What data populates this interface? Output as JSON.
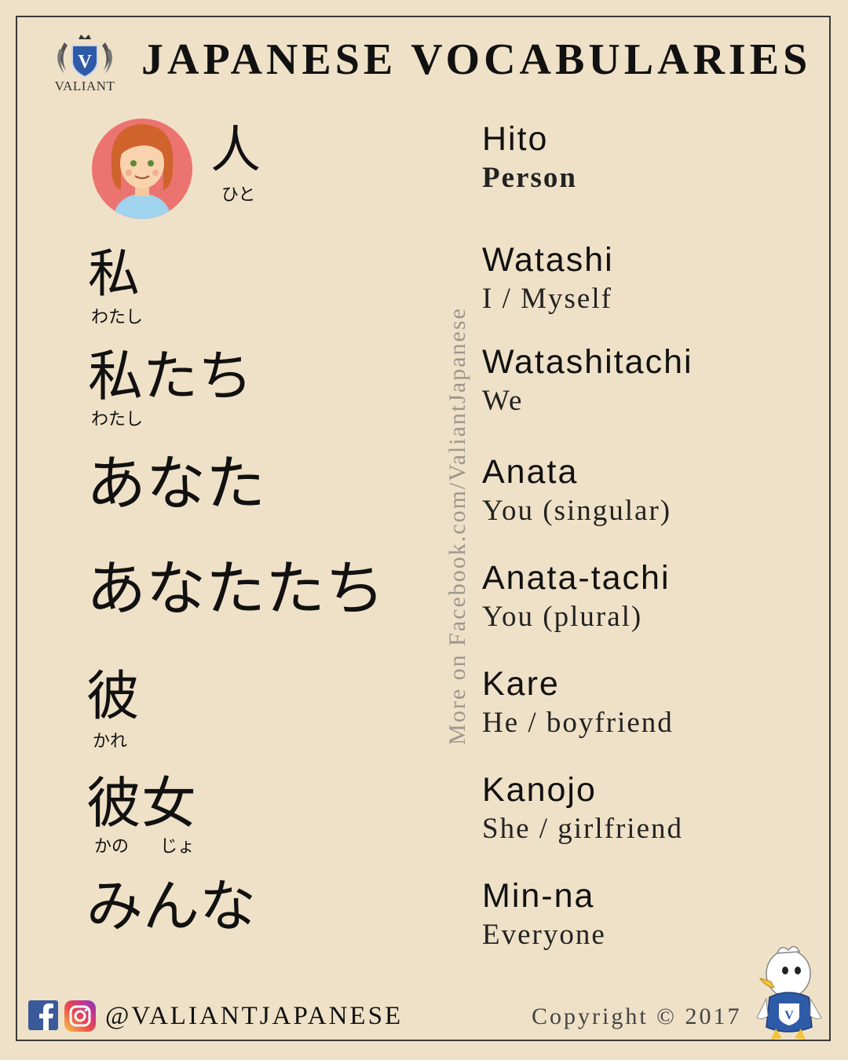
{
  "header": {
    "logo_text": "VALIANT",
    "title": "JAPANESE VOCABULARIES"
  },
  "side_text": "More on Facebook.com/ValiantJapanese",
  "entries": [
    {
      "kanji": "人",
      "furigana": "ひと",
      "romaji": "Hito",
      "meaning": "Person"
    },
    {
      "kanji": "私",
      "furigana": "わたし",
      "romaji": "Watashi",
      "meaning": "I / Myself"
    },
    {
      "kanji": "私たち",
      "furigana": "わたし",
      "romaji": "Watashitachi",
      "meaning": "We"
    },
    {
      "kanji": "あなた",
      "furigana": "",
      "romaji": "Anata",
      "meaning": "You (singular)"
    },
    {
      "kanji": "あなたたち",
      "furigana": "",
      "romaji": "Anata-tachi",
      "meaning": "You (plural)"
    },
    {
      "kanji": "彼",
      "furigana": "かれ",
      "romaji": "Kare",
      "meaning": "He / boyfriend"
    },
    {
      "kanji": "彼女",
      "furigana_1": "かの",
      "furigana_2": "じょ",
      "romaji": "Kanojo",
      "meaning": "She / girlfriend"
    },
    {
      "kanji": "みんな",
      "furigana": "",
      "romaji": "Min-na",
      "meaning": "Everyone"
    }
  ],
  "footer": {
    "handle": "@VALIANTJAPANESE",
    "copyright": "Copyright © 2017"
  },
  "icons": [
    "valiant-crest-icon",
    "facebook-icon",
    "instagram-icon",
    "eagle-mascot-icon",
    "person-avatar-icon"
  ],
  "colors": {
    "background": "#efe1c7",
    "facebook": "#3b5a9a",
    "side_text": "#9c968d"
  }
}
